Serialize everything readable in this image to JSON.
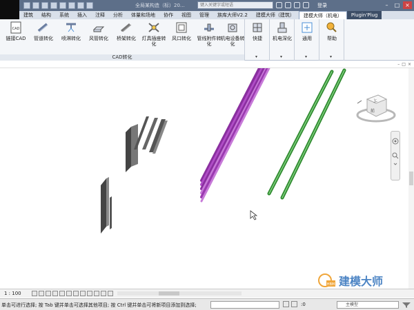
{
  "titlebar": {
    "doc_title": "全局某构造（标）20…",
    "search_placeholder": "键入关键字或短语",
    "login": "登录"
  },
  "tabs": [
    {
      "label": "建筑"
    },
    {
      "label": "结构"
    },
    {
      "label": "系统"
    },
    {
      "label": "插入"
    },
    {
      "label": "注释"
    },
    {
      "label": "分析"
    },
    {
      "label": "体量和场地"
    },
    {
      "label": "协作"
    },
    {
      "label": "视图"
    },
    {
      "label": "管理"
    },
    {
      "label": "族库大师V2.2"
    },
    {
      "label": "建模大师（建筑）"
    },
    {
      "label": "建模大师（机电）",
      "active": true
    },
    {
      "label": "Plugin'Plug"
    }
  ],
  "ribbon": {
    "cad_group_label": "CAD转化",
    "buttons": [
      {
        "label": "链接CAD",
        "icon": "cad-link-icon"
      },
      {
        "label": "管道转化",
        "icon": "pipe-convert-icon"
      },
      {
        "label": "喷淋转化",
        "icon": "sprinkler-convert-icon"
      },
      {
        "label": "风管转化",
        "icon": "duct-convert-icon"
      },
      {
        "label": "桥架转化",
        "icon": "cable-tray-convert-icon"
      },
      {
        "label": "灯具插座转化",
        "icon": "lighting-convert-icon"
      },
      {
        "label": "风口转化",
        "icon": "air-terminal-convert-icon"
      },
      {
        "label": "管线附件转化",
        "icon": "pipe-accessory-convert-icon"
      },
      {
        "label": "机电设备转化",
        "icon": "mep-equipment-convert-icon"
      }
    ],
    "extra_buttons": [
      {
        "label": "快捷",
        "icon": "shortcut-icon"
      },
      {
        "label": "机电深化",
        "icon": "mep-deepen-icon"
      },
      {
        "label": "通用",
        "icon": "general-icon"
      },
      {
        "label": "帮助",
        "icon": "help-icon"
      }
    ]
  },
  "viewbar": {
    "scale": "1 : 100"
  },
  "statusbar": {
    "text": "单击可进行选择; 按 Tab 键并单击可选择其他项目; 按 Ctrl 键并单击可将新项目添加到选择;",
    "count": ":0",
    "model_select": "主模型"
  },
  "watermark": {
    "text": "建模大师",
    "badge": "HBM"
  },
  "colors": {
    "titlebar": "#5d6f89",
    "duct": "#b04cc7",
    "pipe": "#3fa83f",
    "panel": "#555555"
  }
}
